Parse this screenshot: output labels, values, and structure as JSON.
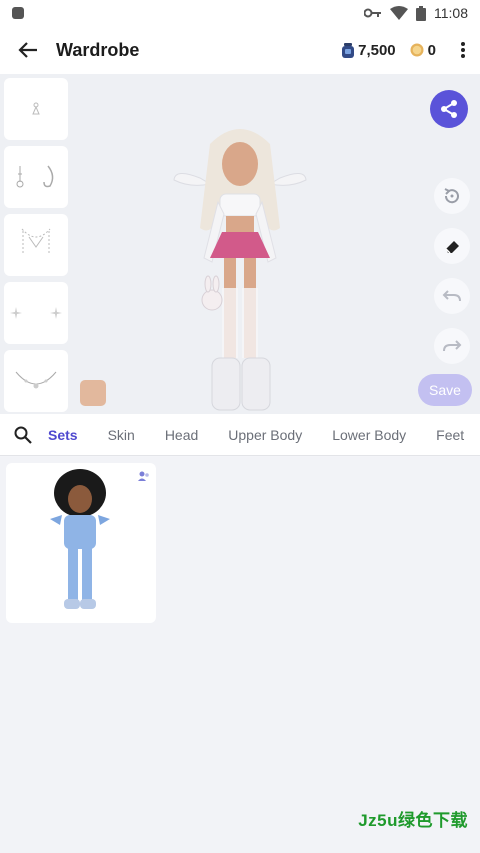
{
  "status_bar": {
    "time": "11:08"
  },
  "app_bar": {
    "title": "Wardrobe",
    "gems": "7,500",
    "coins": "0"
  },
  "thumbnails": [
    {
      "name": "earring-small"
    },
    {
      "name": "earrings-hoop"
    },
    {
      "name": "necklace-chain"
    },
    {
      "name": "face-sparkles"
    },
    {
      "name": "necklace-pendant"
    }
  ],
  "save_label": "Save",
  "tabs": [
    "Sets",
    "Skin",
    "Head",
    "Upper Body",
    "Lower Body",
    "Feet"
  ],
  "active_tab": "Sets",
  "colors": {
    "accent": "#5a53d9",
    "save_disabled": "#c3c0f1",
    "skin_swatch": "#e2b89d"
  },
  "watermark": "Jz5u绿色下载"
}
